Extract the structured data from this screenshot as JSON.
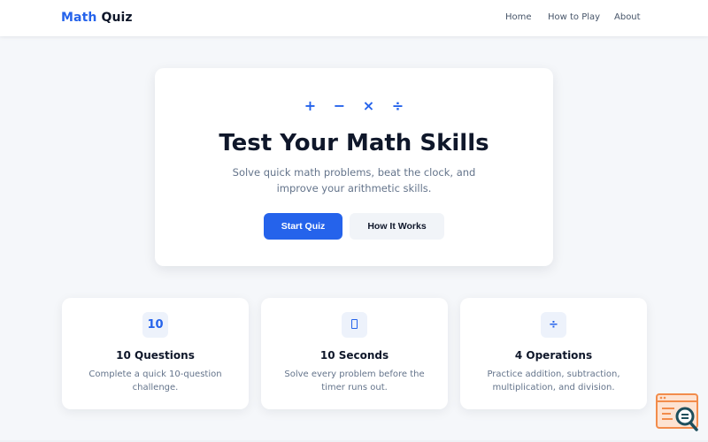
{
  "nav": {
    "brand_accent": "Math",
    "brand_rest": "Quiz",
    "links": [
      "Home",
      "How to Play",
      "About"
    ]
  },
  "hero": {
    "operators": [
      "+",
      "−",
      "×",
      "÷"
    ],
    "title": "Test Your Math Skills",
    "subtitle": "Solve quick math problems, beat the clock, and improve your arithmetic skills.",
    "primary_button": "Start Quiz",
    "secondary_button": "How It Works"
  },
  "features": [
    {
      "icon_text": "10",
      "icon": "number-icon",
      "title": "10 Questions",
      "desc": "Complete a quick 10-question challenge."
    },
    {
      "icon_text": "",
      "icon": "timer-icon",
      "title": "10 Seconds",
      "desc": "Solve every problem before the timer runs out."
    },
    {
      "icon_text": "÷",
      "icon": "divide-icon",
      "title": "4 Operations",
      "desc": "Practice addition, subtraction, multiplication, and division."
    }
  ],
  "colors": {
    "accent": "#2563eb",
    "background": "#f5f7fa",
    "text": "#0f172a",
    "muted": "#64748b",
    "widget": "#f28c4b",
    "widget_dark": "#1e4f5c"
  }
}
